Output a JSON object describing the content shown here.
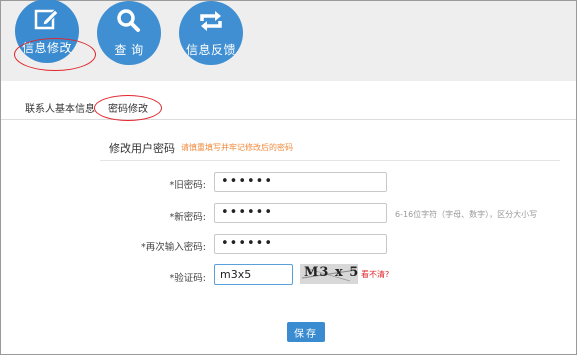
{
  "nav": {
    "items": [
      {
        "label": "信息修改",
        "icon": "edit-icon"
      },
      {
        "label": "查 询",
        "icon": "search-icon"
      },
      {
        "label": "信息反馈",
        "icon": "refresh-icon"
      }
    ]
  },
  "tabs": [
    {
      "label": "联系人基本信息"
    },
    {
      "label": "密码修改"
    }
  ],
  "section": {
    "title": "修改用户密码",
    "hint": "请慎重填写并牢记修改后的密码"
  },
  "form": {
    "old_password": {
      "label": "*旧密码:",
      "value": "••••••"
    },
    "new_password": {
      "label": "*新密码:",
      "value": "••••••",
      "hint": "6-16位字符（字母、数字），区分大小写"
    },
    "confirm_password": {
      "label": "*再次输入密码:",
      "value": "••••••"
    },
    "captcha": {
      "label": "*验证码:",
      "value": "m3x5",
      "image_text": "M3 x 5",
      "refresh_label": "看不清?"
    }
  },
  "save_label": "保存",
  "colors": {
    "accent": "#3a8bd0",
    "warning": "#f08a3c",
    "annotation": "#e0262b"
  }
}
